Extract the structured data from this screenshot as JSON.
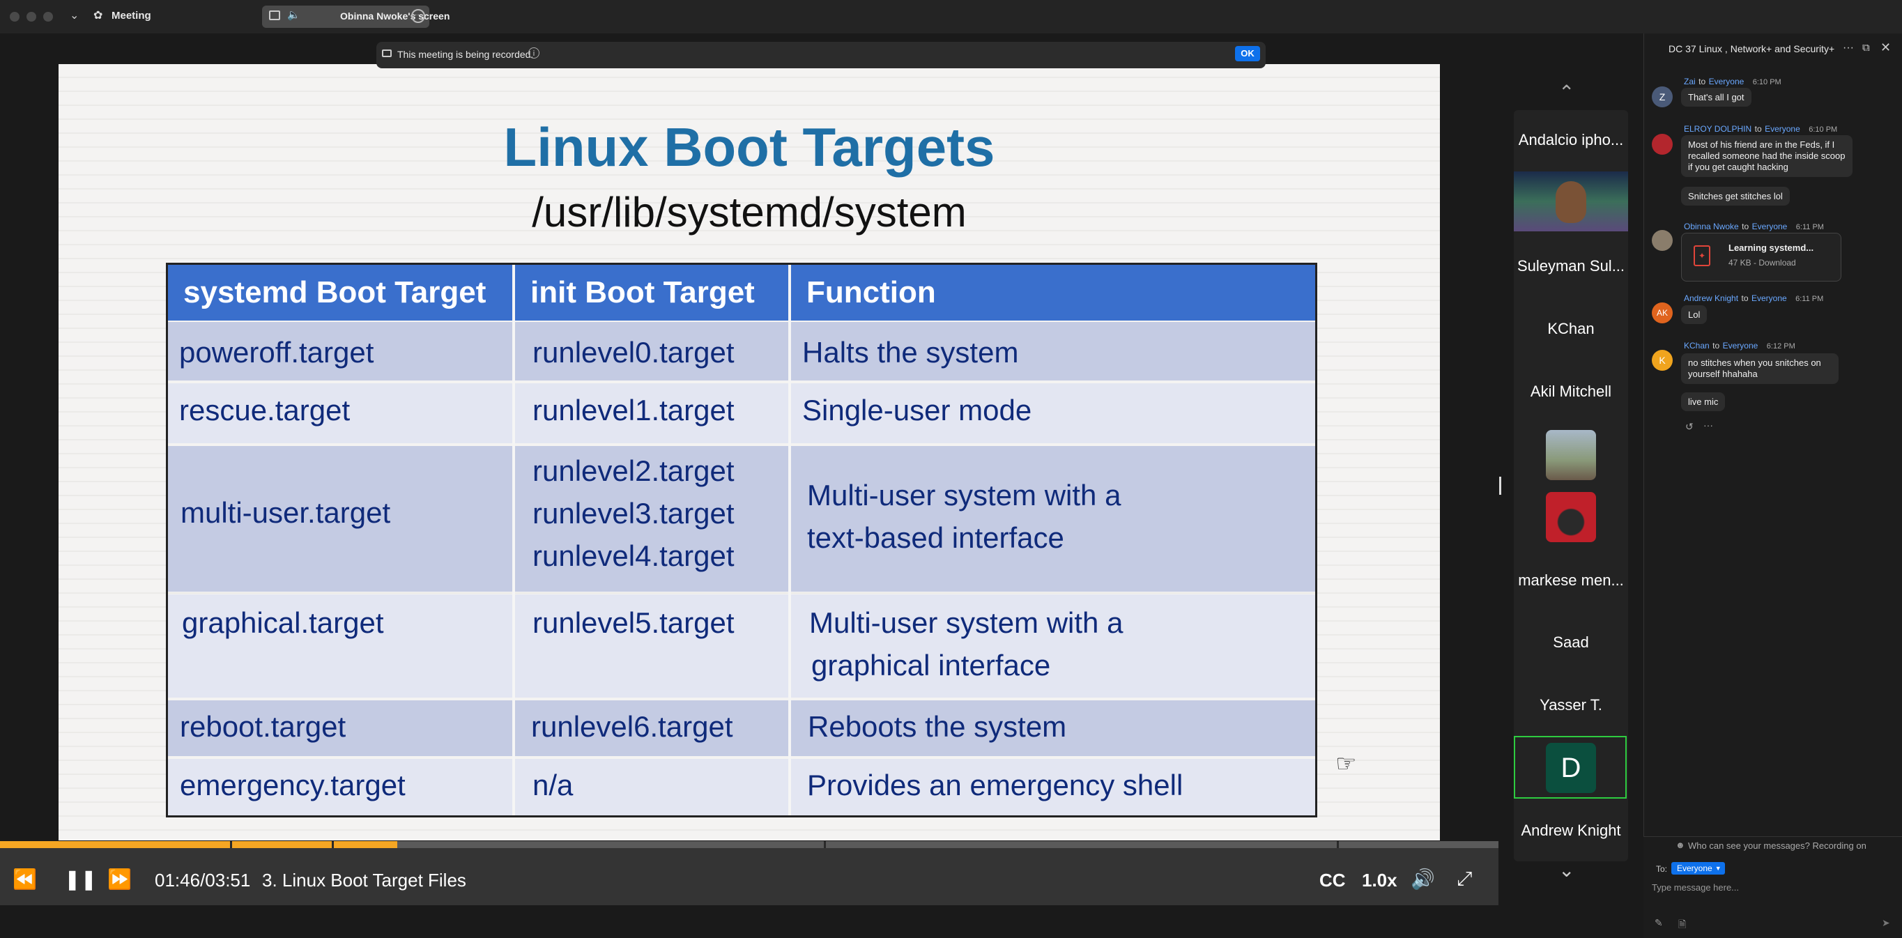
{
  "window": {
    "title": "Meeting",
    "share_label": "Obinna Nwoke's screen"
  },
  "recording": {
    "text": "This meeting is being recorded.",
    "ok_label": "OK"
  },
  "slide": {
    "title": "Linux Boot Targets",
    "subtitle": "/usr/lib/systemd/system",
    "headers": [
      "systemd Boot Target",
      "init Boot Target",
      "Function"
    ],
    "rows": [
      {
        "systemd": "poweroff.target",
        "init": [
          "runlevel0.target"
        ],
        "function": [
          "Halts the system"
        ]
      },
      {
        "systemd": "rescue.target",
        "init": [
          "runlevel1.target"
        ],
        "function": [
          "Single-user mode"
        ]
      },
      {
        "systemd": "multi-user.target",
        "init": [
          "runlevel2.target",
          "runlevel3.target",
          "runlevel4.target"
        ],
        "function": [
          "Multi-user system with a",
          "text-based interface"
        ]
      },
      {
        "systemd": "graphical.target",
        "init": [
          "runlevel5.target"
        ],
        "function": [
          "Multi-user system with a",
          "graphical interface"
        ]
      },
      {
        "systemd": "reboot.target",
        "init": [
          "runlevel6.target"
        ],
        "function": [
          "Reboots the system"
        ]
      },
      {
        "systemd": "emergency.target",
        "init": [
          "n/a"
        ],
        "function": [
          "Provides an emergency shell"
        ]
      }
    ]
  },
  "player": {
    "time": "01:46/03:51",
    "chapter": "3. Linux Boot Target Files",
    "cc_label": "CC",
    "speed_label": "1.0x",
    "progress": 0.265
  },
  "participants": {
    "names": [
      "Andalcio ipho...",
      "Suleyman Sul...",
      "KChan",
      "Akil Mitchell",
      "markese men...",
      "Saad",
      "Yasser T.",
      "Andrew Knight"
    ],
    "active_initial": "D"
  },
  "chat": {
    "title": "DC 37 Linux , Network+ and Security+",
    "to_word": "to",
    "messages": [
      {
        "avatar": "Z",
        "avatar_color": "#4a5a78",
        "sender": "Zai",
        "recipient": "Everyone",
        "time": "6:10 PM",
        "bubbles": [
          "That's all I got"
        ]
      },
      {
        "avatar": "",
        "avatar_color": "#b3262d",
        "sender": "ELROY DOLPHIN",
        "recipient": "Everyone",
        "time": "6:10 PM",
        "bubbles": [
          "Most of his friend are in the Feds, if I recalled someone had the inside scoop if you get caught hacking",
          "Snitches get stitches lol"
        ]
      },
      {
        "avatar": "",
        "avatar_color": "#8a7d6b",
        "sender": "Obinna Nwoke",
        "recipient": "Everyone",
        "time": "6:11 PM",
        "file_name": "Learning systemd...",
        "file_meta": "47 KB - Download"
      },
      {
        "avatar": "AK",
        "avatar_color": "#e0641e",
        "sender": "Andrew Knight",
        "recipient": "Everyone",
        "time": "6:11 PM",
        "bubbles": [
          "Lol"
        ]
      },
      {
        "avatar": "K",
        "avatar_color": "#f0a41e",
        "sender": "KChan",
        "recipient": "Everyone",
        "time": "6:12 PM",
        "bubbles": [
          "no stitches when you snitches on yourself  hhahaha",
          "live mic"
        ]
      }
    ],
    "privacy_note": "Who can see your messages? Recording on",
    "to_label": "To:",
    "recipient_select": "Everyone",
    "input_placeholder": "Type message here..."
  },
  "colors": {
    "accent": "#0e71eb",
    "slide_title": "#1f6fa6",
    "table_header": "#3a6fcc",
    "row_dark": "#c4cbe3",
    "row_light": "#e3e6f2",
    "progress": "#f5a623",
    "active_tile": "#2ecc40"
  }
}
